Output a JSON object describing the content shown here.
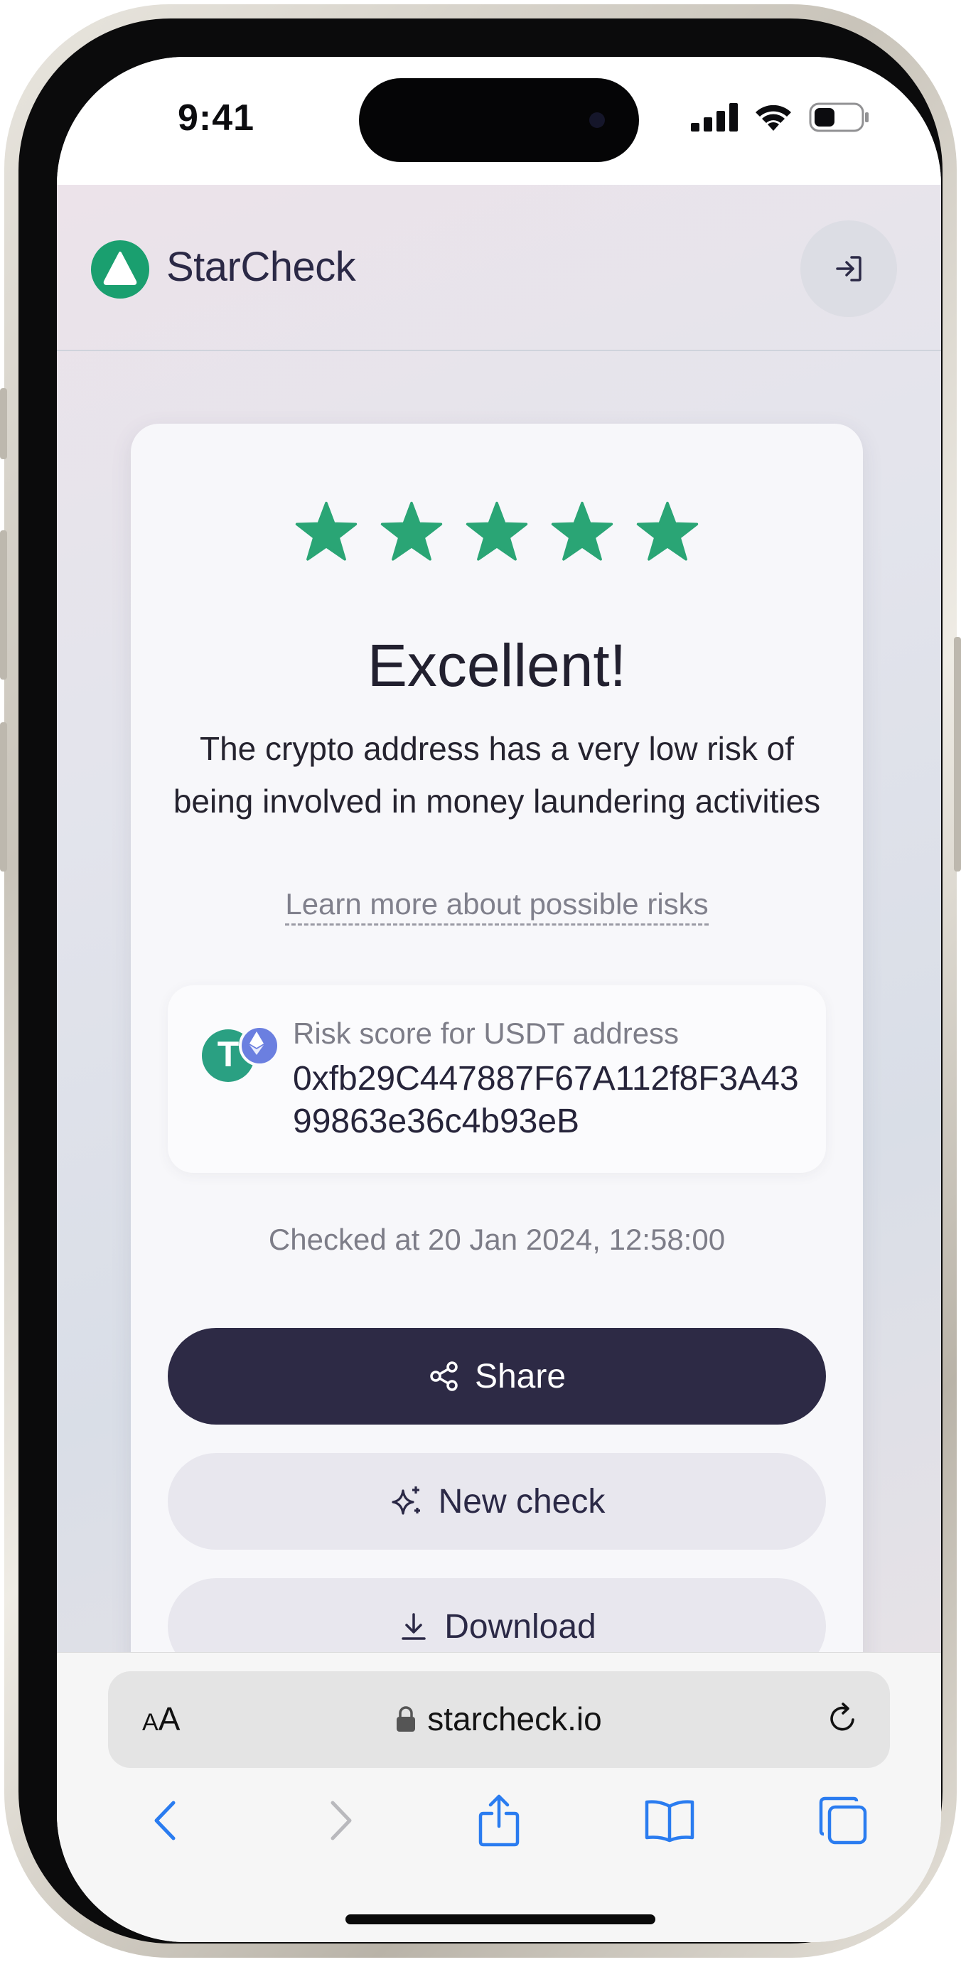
{
  "status_bar": {
    "time": "9:41"
  },
  "header": {
    "brand": "StarCheck"
  },
  "result": {
    "rating_stars": 5,
    "rating_max": 5,
    "headline": "Excellent!",
    "description": "The crypto address has a very low risk of being involved in money laundering activities",
    "learn_more": "Learn more about possible risks",
    "risk_label": "Risk score for USDT address",
    "address": "0xfb29C447887F67A112f8F3A4399863e36c4b93eB",
    "checked_at": "Checked at 20 Jan 2024, 12:58:00"
  },
  "actions": {
    "share": "Share",
    "new_check": "New check",
    "download": "Download"
  },
  "browser": {
    "aa_small": "A",
    "aa_large": "A",
    "url": "starcheck.io"
  },
  "colors": {
    "brand_green": "#1a9f6f",
    "star_green": "#2aa575",
    "primary_dark": "#2d2a45",
    "safari_blue": "#2a7cf0"
  },
  "icons": {
    "login": "login-icon",
    "share": "share-icon",
    "new_check": "sparkles-icon",
    "download": "download-icon",
    "lock": "lock-icon",
    "reload": "reload-icon",
    "back": "chevron-left-icon",
    "forward": "chevron-right-icon",
    "share_sheet": "share-sheet-icon",
    "bookmarks": "book-icon",
    "tabs": "tabs-icon"
  }
}
